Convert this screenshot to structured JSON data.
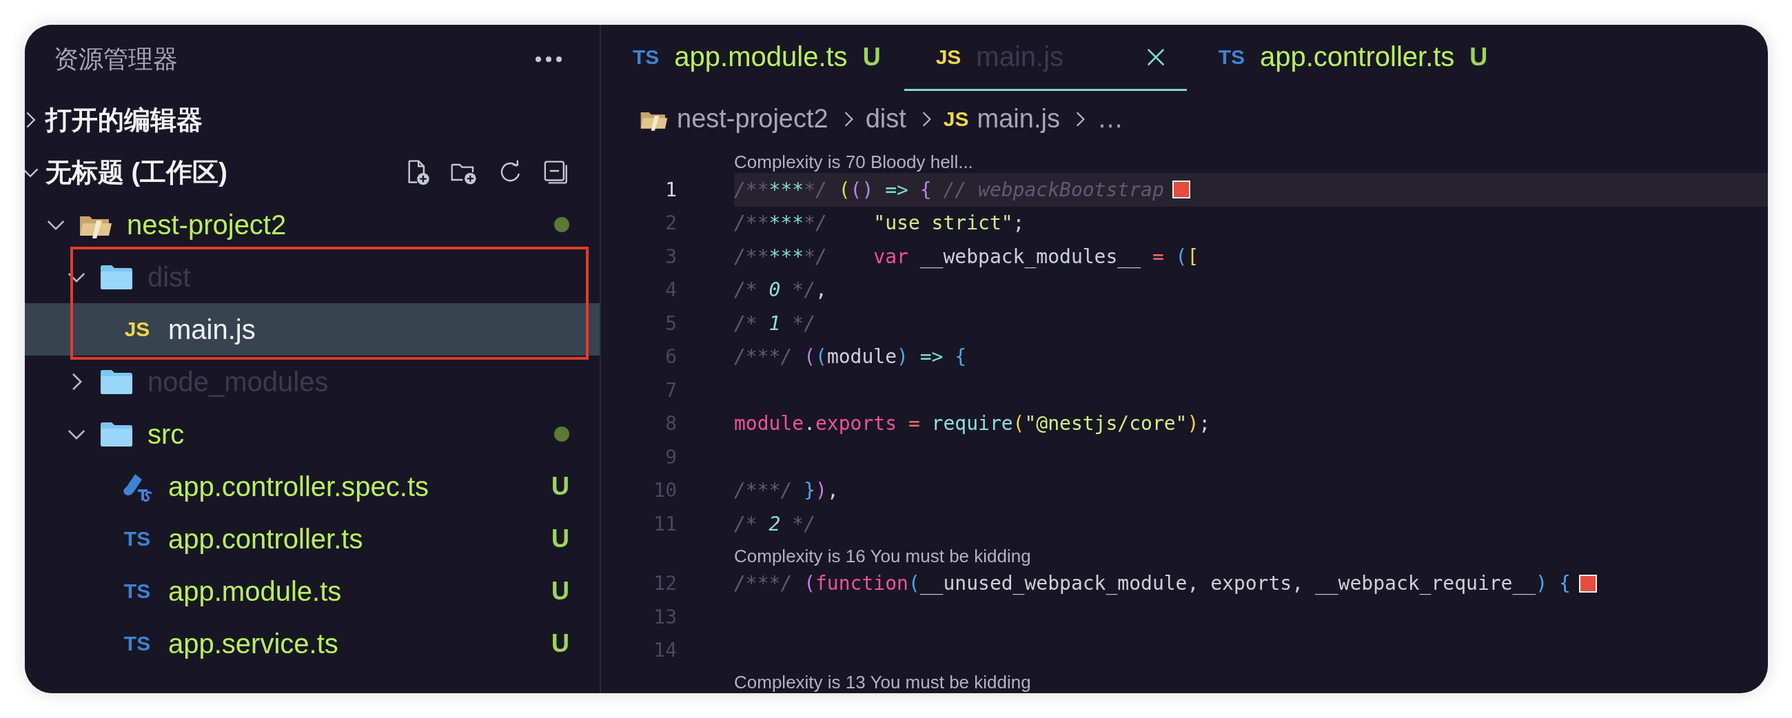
{
  "explorer": {
    "title": "资源管理器",
    "sections": [
      {
        "title": "打开的编辑器",
        "expanded": false,
        "has_toolbar": false
      },
      {
        "title": "无标题 (工作区)",
        "expanded": true,
        "has_toolbar": true
      }
    ],
    "tree": [
      {
        "label": "nest-project2",
        "kind": "project",
        "expanded": true,
        "untracked": true,
        "ignored": false,
        "selected": false,
        "outlined": false,
        "modified_dot": true,
        "children": [
          {
            "label": "dist",
            "kind": "folder",
            "expanded": true,
            "ignored": true,
            "selected": false,
            "outlined": true,
            "modified_dot": false,
            "children": [
              {
                "label": "main.js",
                "kind": "js",
                "icon_label": "JS",
                "untracked": false,
                "ignored": false,
                "selected": true,
                "outlined": true,
                "modified_dot": false
              }
            ]
          },
          {
            "label": "node_modules",
            "kind": "folder",
            "expanded": false,
            "ignored": true,
            "selected": false,
            "outlined": false,
            "modified_dot": false
          },
          {
            "label": "src",
            "kind": "folder",
            "expanded": true,
            "untracked": true,
            "ignored": false,
            "selected": false,
            "outlined": false,
            "modified_dot": true,
            "children": [
              {
                "label": "app.controller.spec.ts",
                "kind": "test",
                "untracked": true,
                "ignored": false,
                "selected": false,
                "outlined": false,
                "git_status": "U"
              },
              {
                "label": "app.controller.ts",
                "kind": "ts",
                "icon_label": "TS",
                "untracked": true,
                "ignored": false,
                "selected": false,
                "outlined": false,
                "git_status": "U"
              },
              {
                "label": "app.module.ts",
                "kind": "ts",
                "icon_label": "TS",
                "untracked": true,
                "ignored": false,
                "selected": false,
                "outlined": false,
                "git_status": "U"
              },
              {
                "label": "app.service.ts",
                "kind": "ts",
                "icon_label": "TS",
                "untracked": true,
                "ignored": false,
                "selected": false,
                "outlined": false,
                "git_status": "U"
              }
            ]
          }
        ]
      }
    ]
  },
  "tabs": [
    {
      "kind": "ts",
      "icon_label": "TS",
      "label": "app.module.ts",
      "git_status": "U",
      "untracked": true,
      "ignored": false,
      "selected": false
    },
    {
      "kind": "js",
      "icon_label": "JS",
      "label": "main.js",
      "ignored": true,
      "selected": true
    },
    {
      "kind": "ts",
      "icon_label": "TS",
      "label": "app.controller.ts",
      "git_status": "U",
      "untracked": true,
      "ignored": false,
      "selected": false
    }
  ],
  "breadcrumbs": [
    {
      "kind": "project",
      "label": "nest-project2"
    },
    {
      "kind": "folder",
      "label": "dist"
    },
    {
      "kind": "js",
      "icon_label": "JS",
      "label": "main.js"
    },
    {
      "kind": "more",
      "label": "…"
    }
  ],
  "editor": {
    "lines": [
      {
        "kind": "codelens",
        "text": "Complexity is 70 Bloody hell..."
      },
      {
        "kind": "code",
        "number": "1",
        "current": true,
        "marker": true,
        "tokens": [
          {
            "kind": "comment",
            "text": "/**"
          },
          {
            "kind": "stars",
            "text": "***"
          },
          {
            "kind": "comment",
            "text": "*/"
          },
          {
            "kind": "p1",
            "text": " ("
          },
          {
            "kind": "p2",
            "text": "()"
          },
          {
            "kind": "arrow",
            "text": " =>"
          },
          {
            "kind": "p2",
            "text": " {"
          },
          {
            "kind": "comment",
            "text": " // webpackBootstrap"
          }
        ]
      },
      {
        "kind": "code",
        "number": "2",
        "current": false,
        "marker": false,
        "tokens": [
          {
            "kind": "comment",
            "text": "/**"
          },
          {
            "kind": "stars",
            "text": "***"
          },
          {
            "kind": "comment",
            "text": "*/"
          },
          {
            "kind": "string",
            "text": "    \"use strict\""
          },
          {
            "kind": "plain",
            "text": ";"
          }
        ]
      },
      {
        "kind": "code",
        "number": "3",
        "current": false,
        "marker": false,
        "tokens": [
          {
            "kind": "comment",
            "text": "/**"
          },
          {
            "kind": "stars",
            "text": "***"
          },
          {
            "kind": "comment",
            "text": "*/"
          },
          {
            "kind": "keyword",
            "text": "    var"
          },
          {
            "kind": "plain",
            "text": " __webpack_modules__ "
          },
          {
            "kind": "op",
            "text": "="
          },
          {
            "kind": "p3",
            "text": " ("
          },
          {
            "kind": "p1",
            "text": "["
          }
        ]
      },
      {
        "kind": "code",
        "number": "4",
        "current": false,
        "marker": false,
        "tokens": [
          {
            "kind": "comment",
            "text": "/* "
          },
          {
            "kind": "num",
            "text": "0"
          },
          {
            "kind": "comment",
            "text": " */"
          },
          {
            "kind": "plain",
            "text": ","
          }
        ]
      },
      {
        "kind": "code",
        "number": "5",
        "current": false,
        "marker": false,
        "tokens": [
          {
            "kind": "comment",
            "text": "/* "
          },
          {
            "kind": "num",
            "text": "1"
          },
          {
            "kind": "comment",
            "text": " */"
          }
        ]
      },
      {
        "kind": "code",
        "number": "6",
        "current": false,
        "marker": false,
        "tokens": [
          {
            "kind": "comment",
            "text": "/***/"
          },
          {
            "kind": "p2",
            "text": " ("
          },
          {
            "kind": "p3",
            "text": "("
          },
          {
            "kind": "plain",
            "text": "module"
          },
          {
            "kind": "p3",
            "text": ")"
          },
          {
            "kind": "arrow",
            "text": " =>"
          },
          {
            "kind": "p3",
            "text": " {"
          }
        ]
      },
      {
        "kind": "code",
        "number": "7",
        "current": false,
        "marker": false
      },
      {
        "kind": "code",
        "number": "8",
        "current": false,
        "marker": false,
        "tokens": [
          {
            "kind": "keyword",
            "text": "module"
          },
          {
            "kind": "plain",
            "text": "."
          },
          {
            "kind": "keyword",
            "text": "exports"
          },
          {
            "kind": "op",
            "text": " ="
          },
          {
            "kind": "func",
            "text": " require"
          },
          {
            "kind": "p1",
            "text": "("
          },
          {
            "kind": "string",
            "text": "\"@nestjs/core\""
          },
          {
            "kind": "p1",
            "text": ")"
          },
          {
            "kind": "plain",
            "text": ";"
          }
        ]
      },
      {
        "kind": "code",
        "number": "9",
        "current": false,
        "marker": false
      },
      {
        "kind": "code",
        "number": "10",
        "current": false,
        "marker": false,
        "tokens": [
          {
            "kind": "comment",
            "text": "/***/"
          },
          {
            "kind": "p3",
            "text": " }"
          },
          {
            "kind": "p2",
            "text": ")"
          },
          {
            "kind": "plain",
            "text": ","
          }
        ]
      },
      {
        "kind": "code",
        "number": "11",
        "current": false,
        "marker": false,
        "tokens": [
          {
            "kind": "comment",
            "text": "/* "
          },
          {
            "kind": "num",
            "text": "2"
          },
          {
            "kind": "comment",
            "text": " */"
          }
        ]
      },
      {
        "kind": "codelens",
        "text": "Complexity is 16 You must be kidding"
      },
      {
        "kind": "code",
        "number": "12",
        "current": false,
        "marker": true,
        "tokens": [
          {
            "kind": "comment",
            "text": "/***/"
          },
          {
            "kind": "p2",
            "text": " ("
          },
          {
            "kind": "keyword",
            "text": "function"
          },
          {
            "kind": "p3",
            "text": "("
          },
          {
            "kind": "plain",
            "text": "__unused_webpack_module, exports, __webpack_require__"
          },
          {
            "kind": "p3",
            "text": ")"
          },
          {
            "kind": "p3",
            "text": " {"
          }
        ]
      },
      {
        "kind": "code",
        "number": "13",
        "current": false,
        "marker": false
      },
      {
        "kind": "code",
        "number": "14",
        "current": false,
        "marker": false
      },
      {
        "kind": "codelens",
        "text": "Complexity is 13 You must be kidding"
      }
    ]
  }
}
